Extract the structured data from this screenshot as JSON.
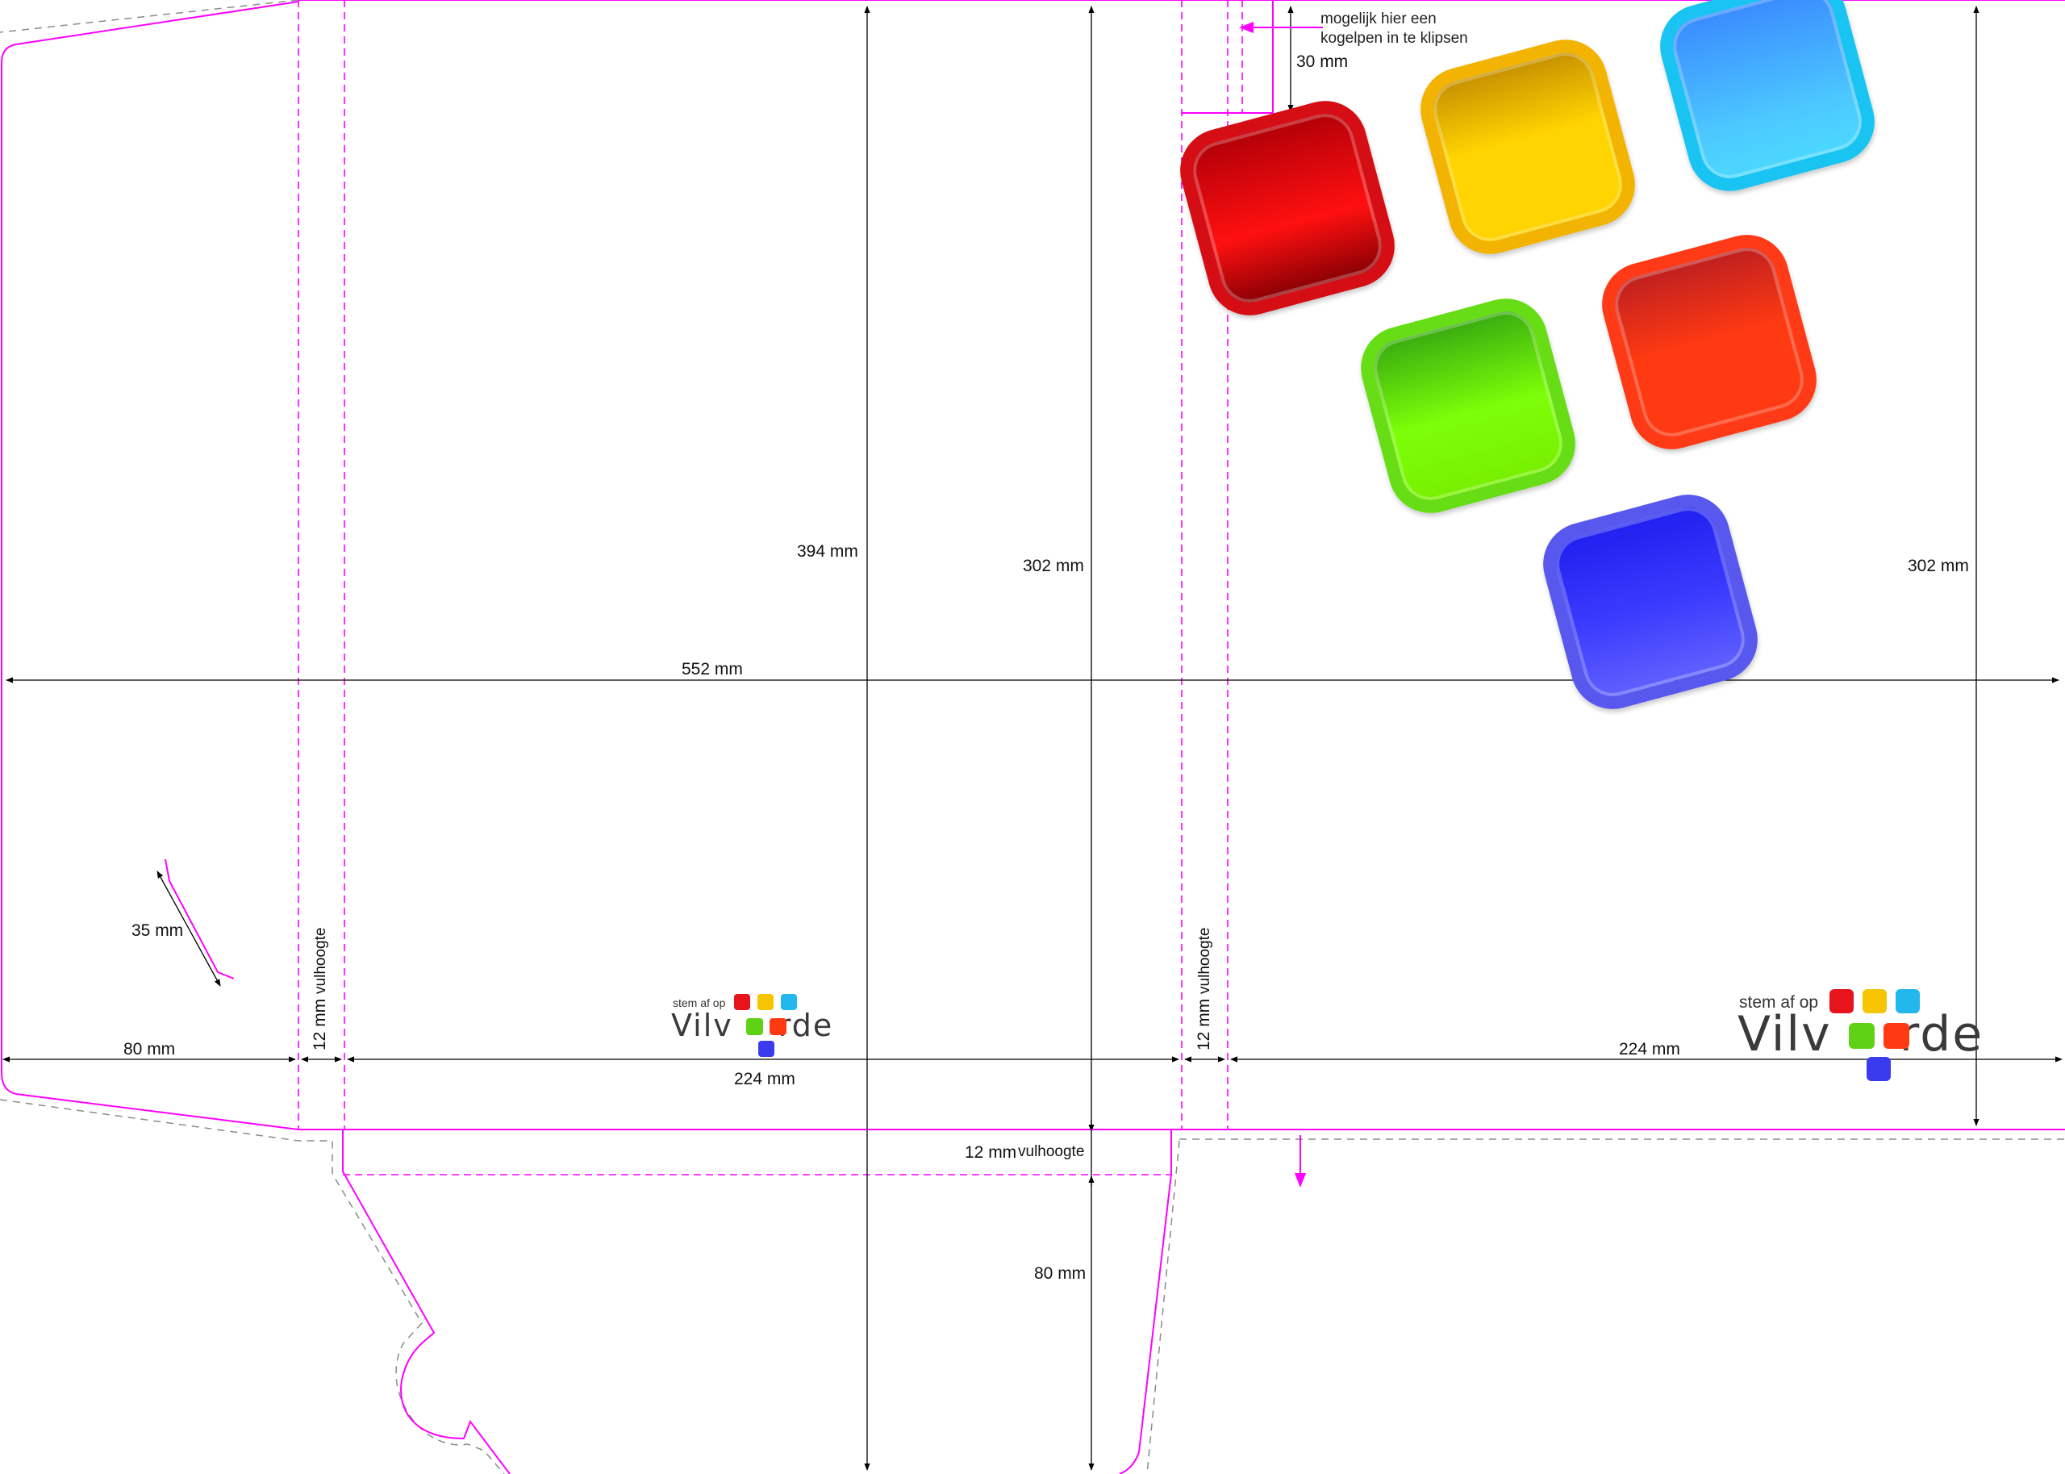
{
  "dimensions": {
    "top_394": "394 mm",
    "mid_302": "302 mm",
    "right_302": "302 mm",
    "width_552": "552 mm",
    "flap_80_left": "80 mm",
    "vulhoogte_12_left_value": "12 mm",
    "vulhoogte_12_left_text": "vulhoogte",
    "vulhoogte_12_mid_value": "12 mm",
    "vulhoogte_12_mid_text": "vulhoogte",
    "panel_224_left": "224 mm",
    "panel_224_right": "224 mm",
    "slot_35": "35 mm",
    "clip_30": "30 mm",
    "bottom_12_value": "12 mm",
    "bottom_12_text": "vulhoogte",
    "bottom_80": "80 mm"
  },
  "note": {
    "line1": "mogelijk hier een",
    "line2": "kogelpen in te klipsen"
  },
  "logo_small": {
    "tagline": "stem af op",
    "word_start": "Vilv",
    "word_end": "rde"
  },
  "logo_large": {
    "tagline": "stem af op",
    "word_start": "Vilv",
    "word_end": "rde"
  },
  "colors": {
    "cut_line": "#ff00ff",
    "crease_line": "#ff00ff",
    "dimension_line": "#000000",
    "bleed_line": "#8c8c8c",
    "squares": [
      "#e8141c",
      "#f4c500",
      "#22b8ee",
      "#5fd216",
      "#ff3a12",
      "#3a3aee"
    ]
  },
  "icons": [
    "red-square-icon",
    "yellow-square-icon",
    "cyan-square-icon",
    "green-square-icon",
    "orange-square-icon",
    "blue-square-icon",
    "note-arrow-icon",
    "down-arrow-icon"
  ]
}
